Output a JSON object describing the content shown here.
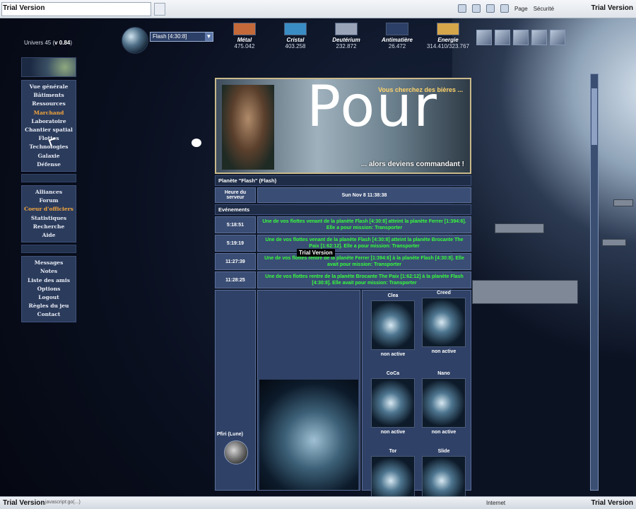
{
  "watermark": {
    "top_left": "Trial Version",
    "top_right": "Trial Version",
    "middle": "Trial Version",
    "bottom_left": "Trial Version",
    "bottom_right": "Trial Version"
  },
  "toolbar": {
    "page_label": "Page",
    "security_label": "Sécurité"
  },
  "universe": {
    "label": "Univers 45 (",
    "version": "v 0.84",
    "label_end": ")"
  },
  "planet_select": {
    "value": "Flash [4:30:8]"
  },
  "resources": [
    {
      "name": "Métal",
      "value": "475.042",
      "color": "#c46a3a"
    },
    {
      "name": "Cristal",
      "value": "403.258",
      "color": "#3a8dc4"
    },
    {
      "name": "Deutérium",
      "value": "232.872",
      "color": "#9aa4b8"
    },
    {
      "name": "Antimatière",
      "value": "26.472",
      "color": "#2c3f66"
    },
    {
      "name": "Energie",
      "value": "314.410/323.767",
      "color": "#d6a64a"
    }
  ],
  "menu": {
    "block1": [
      "Vue générale",
      "Bâtiments",
      "Ressources",
      "Marchand",
      "Laboratoire",
      "Chantier spatial",
      "Flottes",
      "Technologies",
      "Galaxie",
      "Défense"
    ],
    "block2": [
      "Alliances",
      "Forum",
      "Coeur d'officiers",
      "Statistiques",
      "Recherche",
      "Aide"
    ],
    "block3": [
      "Messages",
      "Notes",
      "Liste des amis",
      "Options",
      "Logout",
      "Règles du jeu",
      "Contact"
    ],
    "active": [
      "Marchand",
      "Coeur d'officiers"
    ]
  },
  "banner": {
    "big_text": "Pour",
    "top_text": "Vous cherchez des bières ...",
    "bottom_text": "... alors deviens commandant !"
  },
  "planet_header": "Planète \"Flash\" (Flash)",
  "server_time": {
    "label": "Heure du serveur",
    "value": "Sun Nov 8 11:38:38"
  },
  "events_header": "Evénements",
  "events": [
    {
      "time": "5:18:51",
      "text": "Une de vos flottes venant de la planète Flash [4:30:8] atteint la planète Ferrer [1:394:6]. Elle a pour mission: Transporter"
    },
    {
      "time": "5:19:19",
      "text": "Une de vos flottes venant de la planète Flash [4:30:8] atteint la planète Brocante The Paix [1:62:12]. Elle a pour mission: Transporter"
    },
    {
      "time": "11:27:39",
      "text": "Une de vos flottes rentre de la planète Ferrer [1:394:6] à la planète Flash [4:30:8]. Elle avait pour mission: Transporter"
    },
    {
      "time": "11:28:25",
      "text": "Une de vos flottes rentre de la planète Brocante The Paix [1:62:12] à la planète Flash [4:30:8]. Elle avait pour mission: Transporter"
    }
  ],
  "moon": {
    "label": "Pfiri (Lune)"
  },
  "other_planets": [
    {
      "name": "Clea",
      "status": "non active"
    },
    {
      "name": "Creed",
      "status": "non active"
    },
    {
      "name": "CoCa",
      "status": "non active"
    },
    {
      "name": "Nano",
      "status": "non active"
    },
    {
      "name": "Tor",
      "status": ""
    },
    {
      "name": "Slide",
      "status": ""
    }
  ],
  "statusbar": {
    "url": "javascript:go(...)",
    "zone": "Internet"
  }
}
